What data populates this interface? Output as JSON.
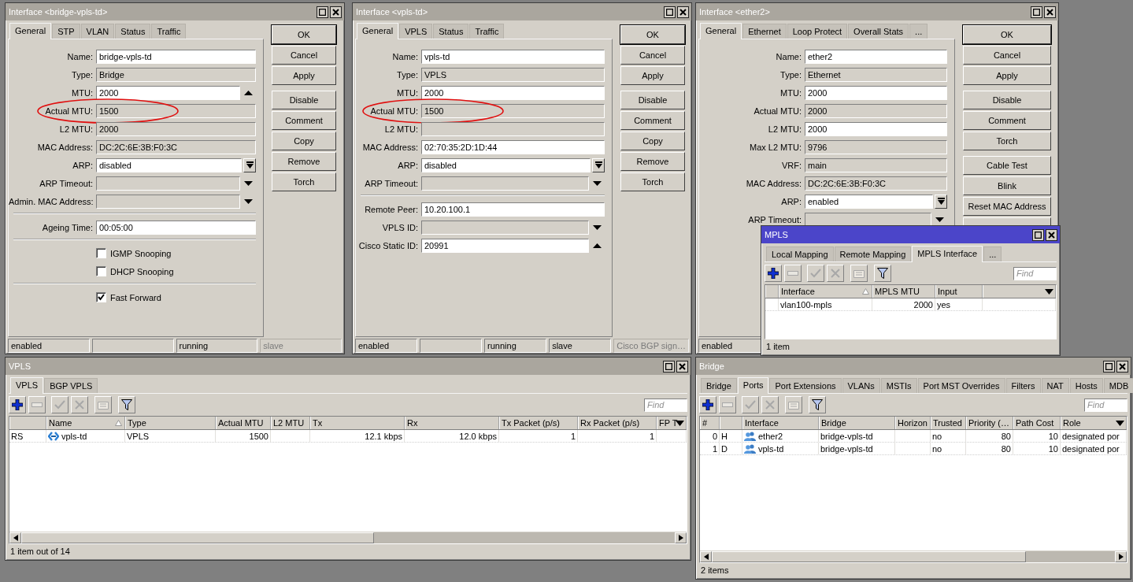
{
  "interface_windows": [
    {
      "title": "Interface <bridge-vpls-td>",
      "active": false,
      "tabs": [
        {
          "label": "General",
          "selected": true
        },
        {
          "label": "STP",
          "selected": false
        },
        {
          "label": "VLAN",
          "selected": false
        },
        {
          "label": "Status",
          "selected": false
        },
        {
          "label": "Traffic",
          "selected": false
        }
      ],
      "fields": [
        {
          "kind": "field",
          "label": "Name:",
          "value": "bridge-vpls-td",
          "editable": true,
          "circled": false
        },
        {
          "kind": "field",
          "label": "Type:",
          "value": "Bridge",
          "editable": false,
          "circled": false
        },
        {
          "kind": "spinner",
          "label": "MTU:",
          "value": "2000",
          "editable": true,
          "circled": false
        },
        {
          "kind": "field",
          "label": "Actual MTU:",
          "value": "1500",
          "editable": false,
          "circled": true
        },
        {
          "kind": "field",
          "label": "L2 MTU:",
          "value": "2000",
          "editable": false,
          "circled": false
        },
        {
          "kind": "field",
          "label": "MAC Address:",
          "value": "DC:2C:6E:3B:F0:3C",
          "editable": false,
          "circled": false
        },
        {
          "kind": "combo",
          "label": "ARP:",
          "value": "disabled",
          "editable": true,
          "circled": false
        },
        {
          "kind": "select",
          "label": "ARP Timeout:",
          "editable": false,
          "circled": false
        },
        {
          "kind": "select",
          "label": "Admin. MAC Address:",
          "editable": false,
          "circled": false
        },
        {
          "kind": "separator"
        },
        {
          "kind": "field",
          "label": "Ageing Time:",
          "value": "00:05:00",
          "editable": true,
          "circled": false
        },
        {
          "kind": "separator"
        },
        {
          "kind": "checkbox",
          "label": "IGMP Snooping",
          "checked": false
        },
        {
          "kind": "checkbox",
          "label": "DHCP Snooping",
          "checked": false
        },
        {
          "kind": "separator"
        },
        {
          "kind": "checkbox",
          "label": "Fast Forward",
          "checked": true
        }
      ],
      "button_groups": [
        [
          {
            "label": "OK",
            "default": true
          },
          {
            "label": "Cancel",
            "default": false
          },
          {
            "label": "Apply",
            "default": false
          }
        ],
        [
          {
            "label": "Disable",
            "default": false
          },
          {
            "label": "Comment",
            "default": false
          },
          {
            "label": "Copy",
            "default": false
          },
          {
            "label": "Remove",
            "default": false
          },
          {
            "label": "Torch",
            "default": false
          }
        ]
      ],
      "status": [
        {
          "text": "enabled",
          "disabled": false
        },
        {
          "disabled": false
        },
        {
          "text": "running",
          "disabled": false
        },
        {
          "text": "slave",
          "disabled": true
        }
      ]
    },
    {
      "title": "Interface <vpls-td>",
      "active": false,
      "tabs": [
        {
          "label": "General",
          "selected": true
        },
        {
          "label": "VPLS",
          "selected": false
        },
        {
          "label": "Status",
          "selected": false
        },
        {
          "label": "Traffic",
          "selected": false
        }
      ],
      "fields": [
        {
          "kind": "field",
          "label": "Name:",
          "value": "vpls-td",
          "editable": true,
          "circled": false
        },
        {
          "kind": "field",
          "label": "Type:",
          "value": "VPLS",
          "editable": false,
          "circled": false
        },
        {
          "kind": "field",
          "label": "MTU:",
          "value": "2000",
          "editable": true,
          "circled": false
        },
        {
          "kind": "field",
          "label": "Actual MTU:",
          "value": "1500",
          "editable": false,
          "circled": true
        },
        {
          "kind": "field",
          "label": "L2 MTU:",
          "editable": false,
          "circled": false
        },
        {
          "kind": "field",
          "label": "MAC Address:",
          "value": "02:70:35:2D:1D:44",
          "editable": true,
          "circled": false
        },
        {
          "kind": "combo",
          "label": "ARP:",
          "value": "disabled",
          "editable": true,
          "circled": false
        },
        {
          "kind": "select",
          "label": "ARP Timeout:",
          "editable": false,
          "circled": false
        },
        {
          "kind": "separator"
        },
        {
          "kind": "field",
          "label": "Remote Peer:",
          "value": "10.20.100.1",
          "editable": true,
          "circled": false
        },
        {
          "kind": "select",
          "label": "VPLS ID:",
          "editable": false,
          "circled": false
        },
        {
          "kind": "spinner",
          "label": "Cisco Static ID:",
          "value": "20991",
          "editable": true,
          "circled": false
        }
      ],
      "button_groups": [
        [
          {
            "label": "OK",
            "default": true
          },
          {
            "label": "Cancel",
            "default": false
          },
          {
            "label": "Apply",
            "default": false
          }
        ],
        [
          {
            "label": "Disable",
            "default": false
          },
          {
            "label": "Comment",
            "default": false
          },
          {
            "label": "Copy",
            "default": false
          },
          {
            "label": "Remove",
            "default": false
          },
          {
            "label": "Torch",
            "default": false
          }
        ]
      ],
      "status": [
        {
          "text": "enabled",
          "disabled": false
        },
        {
          "disabled": false
        },
        {
          "text": "running",
          "disabled": false
        },
        {
          "text": "slave",
          "disabled": false
        },
        {
          "text": "Cisco BGP sign…",
          "disabled": true
        }
      ]
    },
    {
      "title": "Interface <ether2>",
      "active": false,
      "tabs": [
        {
          "label": "General",
          "selected": true
        },
        {
          "label": "Ethernet",
          "selected": false
        },
        {
          "label": "Loop Protect",
          "selected": false
        },
        {
          "label": "Overall Stats",
          "selected": false
        },
        {
          "label": "...",
          "selected": false
        }
      ],
      "fields": [
        {
          "kind": "field",
          "label": "Name:",
          "value": "ether2",
          "editable": true,
          "circled": false
        },
        {
          "kind": "field",
          "label": "Type:",
          "value": "Ethernet",
          "editable": false,
          "circled": false
        },
        {
          "kind": "field",
          "label": "MTU:",
          "value": "2000",
          "editable": true,
          "circled": false
        },
        {
          "kind": "field",
          "label": "Actual MTU:",
          "value": "2000",
          "editable": false,
          "circled": false
        },
        {
          "kind": "field",
          "label": "L2 MTU:",
          "value": "2000",
          "editable": true,
          "circled": false
        },
        {
          "kind": "field",
          "label": "Max L2 MTU:",
          "value": "9796",
          "editable": false,
          "circled": false
        },
        {
          "kind": "field",
          "label": "VRF:",
          "value": "main",
          "editable": false,
          "circled": false
        },
        {
          "kind": "field",
          "label": "MAC Address:",
          "value": "DC:2C:6E:3B:F0:3C",
          "editable": false,
          "circled": false
        },
        {
          "kind": "combo",
          "label": "ARP:",
          "value": "enabled",
          "editable": true,
          "circled": false
        },
        {
          "kind": "select",
          "label": "ARP Timeout:",
          "editable": false,
          "circled": false
        }
      ],
      "button_groups": [
        [
          {
            "label": "OK",
            "default": true
          },
          {
            "label": "Cancel",
            "default": false
          },
          {
            "label": "Apply",
            "default": false
          }
        ],
        [
          {
            "label": "Disable",
            "default": false
          },
          {
            "label": "Comment",
            "default": false
          },
          {
            "label": "Torch",
            "default": false
          }
        ],
        [
          {
            "label": "Cable Test",
            "default": false
          },
          {
            "label": "Blink",
            "default": false
          },
          {
            "label": "Reset MAC Address",
            "default": false
          },
          {
            "default": false
          }
        ]
      ],
      "status": [
        {
          "text": "enabled",
          "disabled": false
        }
      ]
    }
  ],
  "mpls_window": {
    "title": "MPLS",
    "active": true,
    "tabs": [
      {
        "label": "Local Mapping",
        "selected": false
      },
      {
        "label": "Remote Mapping",
        "selected": false
      },
      {
        "label": "MPLS Interface",
        "selected": true
      },
      {
        "label": "...",
        "selected": false
      }
    ],
    "toolbar": [
      {
        "kind": "add",
        "disabled": false
      },
      {
        "kind": "remove",
        "disabled": true
      },
      {
        "kind": "enable",
        "disabled": true
      },
      {
        "kind": "disable",
        "disabled": true
      },
      {
        "kind": "comment",
        "disabled": true
      },
      {
        "kind": "filter",
        "disabled": false
      }
    ],
    "find": {
      "placeholder": "Find"
    },
    "columns": [
      {
        "sorted": false
      },
      {
        "label": "Interface",
        "sorted": true
      },
      {
        "label": "MPLS MTU",
        "sorted": false,
        "right_aligned": true
      },
      {
        "label": "Input",
        "sorted": false
      },
      {
        "sorted": false
      }
    ],
    "rows": [
      {
        "cells": [
          null,
          "vlan100-mpls",
          "2000",
          "yes",
          null
        ]
      }
    ],
    "status": "1 item"
  },
  "vpls_window": {
    "title": "VPLS",
    "active": false,
    "tabs": [
      {
        "label": "VPLS",
        "selected": true
      },
      {
        "label": "BGP VPLS",
        "selected": false
      }
    ],
    "toolbar": [
      {
        "kind": "add",
        "disabled": false
      },
      {
        "kind": "remove",
        "disabled": true
      },
      {
        "kind": "enable",
        "disabled": true
      },
      {
        "kind": "disable",
        "disabled": true
      },
      {
        "kind": "comment",
        "disabled": true
      },
      {
        "kind": "filter",
        "disabled": false
      }
    ],
    "find": {
      "placeholder": "Find"
    },
    "columns": [
      {
        "sorted": false
      },
      {
        "label": "Name",
        "sorted": true
      },
      {
        "label": "Type",
        "sorted": false
      },
      {
        "label": "Actual MTU",
        "sorted": false,
        "right_aligned": true
      },
      {
        "label": "L2 MTU",
        "sorted": false
      },
      {
        "label": "Tx",
        "sorted": false,
        "right_aligned": true
      },
      {
        "label": "Rx",
        "sorted": false,
        "right_aligned": true
      },
      {
        "label": "Tx Packet (p/s)",
        "sorted": false,
        "right_aligned": true
      },
      {
        "label": "Rx Packet (p/s)",
        "sorted": false,
        "right_aligned": true
      },
      {
        "label": "FP T",
        "sorted": false
      }
    ],
    "rows": [
      {
        "cells": [
          "RS",
          {
            "text": "vpls-td",
            "kind": "vpls"
          },
          "VPLS",
          "1500",
          null,
          "12.1 kbps",
          "12.0 kbps",
          "1",
          "1",
          null
        ]
      }
    ],
    "status": "1 item out of 14"
  },
  "bridge_window": {
    "title": "Bridge",
    "active": false,
    "tabs": [
      {
        "label": "Bridge",
        "selected": false
      },
      {
        "label": "Ports",
        "selected": true
      },
      {
        "label": "Port Extensions",
        "selected": false
      },
      {
        "label": "VLANs",
        "selected": false
      },
      {
        "label": "MSTIs",
        "selected": false
      },
      {
        "label": "Port MST Overrides",
        "selected": false
      },
      {
        "label": "Filters",
        "selected": false
      },
      {
        "label": "NAT",
        "selected": false
      },
      {
        "label": "Hosts",
        "selected": false
      },
      {
        "label": "MDB",
        "selected": false
      }
    ],
    "toolbar": [
      {
        "kind": "add",
        "disabled": false
      },
      {
        "kind": "remove",
        "disabled": true
      },
      {
        "kind": "enable",
        "disabled": true
      },
      {
        "kind": "disable",
        "disabled": true
      },
      {
        "kind": "comment",
        "disabled": true
      },
      {
        "kind": "filter",
        "disabled": false
      }
    ],
    "find": {
      "placeholder": "Find"
    },
    "columns": [
      {
        "label": "#",
        "sorted": false,
        "right_aligned": true
      },
      {
        "sorted": false
      },
      {
        "label": "Interface",
        "sorted": false
      },
      {
        "label": "Bridge",
        "sorted": false
      },
      {
        "label": "Horizon",
        "sorted": false
      },
      {
        "label": "Trusted",
        "sorted": false
      },
      {
        "label": "Priority (…",
        "sorted": false,
        "right_aligned": true
      },
      {
        "label": "Path Cost",
        "sorted": false,
        "right_aligned": true
      },
      {
        "label": "Role",
        "sorted": false
      }
    ],
    "rows": [
      {
        "cells": [
          "0",
          "H",
          {
            "text": "ether2",
            "kind": "port"
          },
          "bridge-vpls-td",
          null,
          "no",
          "80",
          "10",
          "designated por"
        ]
      },
      {
        "cells": [
          "1",
          "D",
          {
            "text": "vpls-td",
            "kind": "port"
          },
          "bridge-vpls-td",
          null,
          "no",
          "80",
          "10",
          "designated por"
        ]
      }
    ],
    "status": "2 items"
  }
}
